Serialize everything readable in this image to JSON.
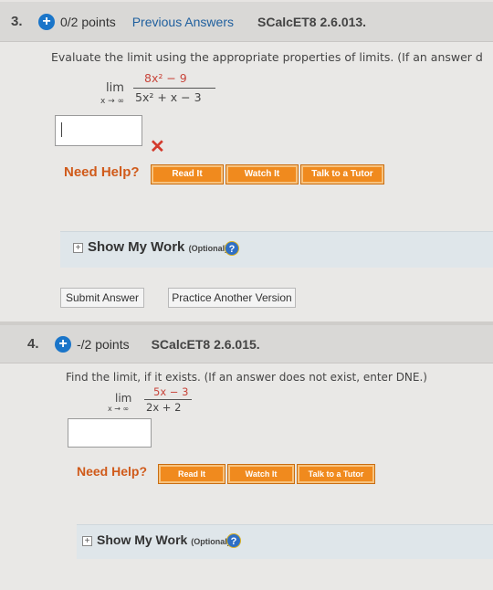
{
  "q3": {
    "number": "3.",
    "points": "0/2 points",
    "previous_answers": "Previous Answers",
    "code": "SCalcET8 2.6.013.",
    "instructions": "Evaluate the limit using the appropriate properties of limits. (If an answer d",
    "limit": {
      "lim": "lim",
      "sub": "x → ∞",
      "numerator": "8x² − 9",
      "denominator": "5x² + x − 3"
    },
    "answer_value": "",
    "status_mark": "✕",
    "need_help": "Need Help?",
    "help_buttons": [
      "Read It",
      "Watch It",
      "Talk to a Tutor"
    ],
    "show_my_work": "Show My Work",
    "optional": "(Optional)",
    "submit": "Submit Answer",
    "practice": "Practice Another Version"
  },
  "q4": {
    "number": "4.",
    "points": "-/2 points",
    "code": "SCalcET8 2.6.015.",
    "instructions": "Find the limit, if it exists. (If an answer does not exist, enter DNE.)",
    "limit": {
      "lim": "lim",
      "sub": "x → ∞",
      "numerator": "5x − 3",
      "denominator": "2x + 2"
    },
    "answer_value": "",
    "need_help": "Need Help?",
    "help_buttons": [
      "Read It",
      "Watch It",
      "Talk to a Tutor"
    ],
    "show_my_work": "Show My Work",
    "optional": "(Optional)"
  },
  "icons": {
    "plus": "+",
    "help": "?",
    "expand": "+"
  }
}
